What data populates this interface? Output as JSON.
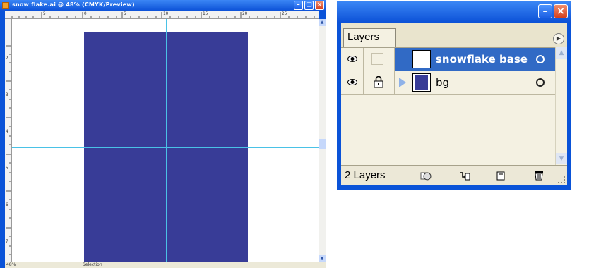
{
  "document_window": {
    "title": "snow flake.ai @ 48% (CMYK/Preview)",
    "ruler_top_labels": [
      "0",
      "5",
      "10",
      "15",
      "20",
      "25"
    ],
    "ruler_left_labels": [
      "2",
      "3",
      "4",
      "5",
      "6",
      "7"
    ],
    "status": {
      "zoom": "48%",
      "label": "Selection"
    }
  },
  "layers_panel": {
    "tab_label": "Layers",
    "layers": [
      {
        "name": "snowflake base",
        "selected": true
      },
      {
        "name": "bg",
        "selected": false
      }
    ],
    "footer_count": "2 Layers"
  },
  "colors": {
    "artboard": "#383c97",
    "guide": "#4ac2e6",
    "selection": "#316ac5",
    "titlebar": "#0a53d8"
  },
  "icons": [
    "illustrator-file-icon",
    "eye-icon",
    "lock-icon",
    "expand-arrow-icon",
    "panel-menu-icon",
    "make-clipping-mask-icon",
    "create-sublayer-icon",
    "new-layer-icon",
    "trash-icon"
  ]
}
